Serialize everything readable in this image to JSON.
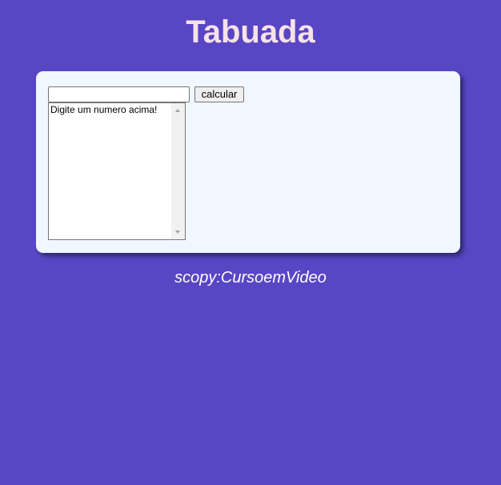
{
  "header": {
    "title": "Tabuada"
  },
  "form": {
    "number_input_value": "",
    "number_input_placeholder": "",
    "calculate_label": "calcular"
  },
  "results": {
    "options": [
      "Digite um numero acima!"
    ]
  },
  "footer": {
    "credit": "scopy:CursoemVideo"
  },
  "colors": {
    "background": "#5946c5",
    "title": "#f7e3e7",
    "panel": "#f0f7ff",
    "footer_text": "#ffffff"
  },
  "icons": {
    "scroll_up": "triangle-up",
    "scroll_down": "triangle-down"
  }
}
